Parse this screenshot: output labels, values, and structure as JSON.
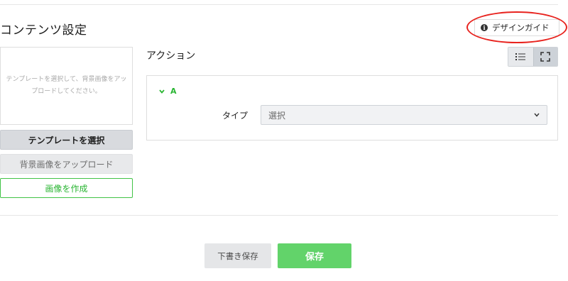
{
  "page": {
    "title": "コンテンツ設定",
    "design_guide_label": "デザインガイド"
  },
  "left_panel": {
    "preview_hint": "テンプレートを選択して、背景画像をアップロードしてください。",
    "select_template_label": "テンプレートを選択",
    "upload_background_label": "背景画像をアップロード",
    "create_image_label": "画像を作成"
  },
  "actions": {
    "section_title": "アクション",
    "items": [
      {
        "name": "A",
        "type_label": "タイプ",
        "type_value": "選択"
      }
    ]
  },
  "footer": {
    "draft_label": "下書き保存",
    "save_label": "保存"
  },
  "icons": {
    "info": "info-icon",
    "list_view": "list-icon",
    "fullscreen": "fullscreen-icon",
    "collapse": "chevron-down-icon",
    "select_caret": "chevron-down-icon"
  },
  "colors": {
    "accent_green": "#29b532",
    "save_green": "#62d36a",
    "annotation_red": "#e8231e"
  }
}
